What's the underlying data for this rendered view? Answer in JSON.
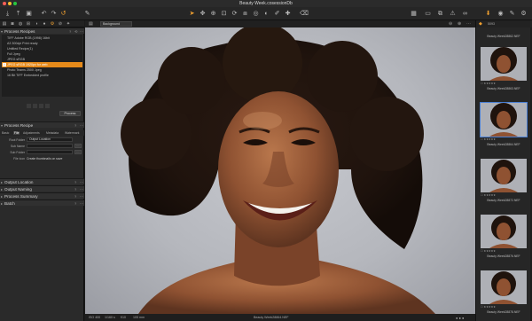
{
  "window": {
    "document_title": "Beauty Week.cosessionDb"
  },
  "toolbar": {
    "left_icons": [
      "import-icon",
      "export-icon",
      "camera-icon",
      "browser-icon",
      "lens-icon",
      "adjust-icon",
      "color-icon",
      "detail-icon",
      "output-icon"
    ],
    "center_icons": [
      "cursor-icon",
      "pan-icon",
      "zoom-icon",
      "crop-icon",
      "rotate-icon",
      "keystone-icon",
      "spot-icon",
      "mask-icon",
      "draw-icon",
      "picker-icon"
    ],
    "right_icons": [
      "grid-icon",
      "viewer-icon",
      "compare-icon",
      "exposure-warning-icon",
      "proof-icon",
      "glasses-icon"
    ],
    "far_right_icons": [
      "orange-process-icon",
      "camera-body-icon",
      "brush-icon",
      "color-pick-icon",
      "settings-icon"
    ]
  },
  "viewer": {
    "background_select": "Background",
    "status_left": [
      "ISO 400",
      "1/160 s",
      "f/10",
      "105 mm"
    ],
    "status_center": "Beauty Week28864.NEF"
  },
  "left_panel": {
    "process_recipes": {
      "title": "Process Recipes",
      "items": [
        "TIFF Adobe RGB (1998) 16bit",
        "A3 300dpi Print ready",
        "Untitled Recipe(1)",
        "Full Jpeg",
        "JPEG sRGB",
        "JPEG sRGB 1920px for web",
        "Photo Teams 2500 Jpeg",
        "16 Bit TIFF Embedded profile"
      ],
      "selected_index": 5,
      "process_button": "Process"
    },
    "process_recipe": {
      "title": "Process Recipe",
      "tabs": [
        "Basic",
        "File",
        "Adjustments",
        "Metadata",
        "Watermark"
      ],
      "active_tab": "File",
      "fields": [
        {
          "label": "Root Folder",
          "value": "Output Location"
        },
        {
          "label": "Sub Name",
          "value": ""
        },
        {
          "label": "Sub Folder",
          "value": ""
        },
        {
          "label": "File Icon",
          "value": "Create thumbnails on save"
        }
      ]
    },
    "collapsed_sections": [
      "Output Location",
      "Output Naming",
      "Process Summary",
      "Batch"
    ]
  },
  "filmstrip": {
    "top_count": "5093",
    "thumbnails": [
      {
        "name": "Beauty Week28862.NEF",
        "selected": false
      },
      {
        "name": "Beauty Week28863.NEF",
        "selected": false
      },
      {
        "name": "Beauty Week28864.NEF",
        "selected": true
      },
      {
        "name": "Beauty Week28872.NEF",
        "selected": false
      },
      {
        "name": "Beauty Week28876.NEF",
        "selected": false
      },
      {
        "name": "Beauty Week28878.NEF",
        "selected": false
      }
    ]
  },
  "colors": {
    "accent": "#e68a1a",
    "selection_blue": "#4a7fd4",
    "panel_bg": "#2a2a2a",
    "viewer_bg": "#161616"
  }
}
